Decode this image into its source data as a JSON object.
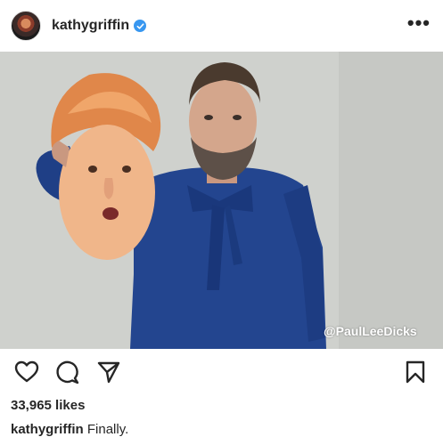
{
  "post": {
    "username": "kathygriffin",
    "verified": true,
    "more_label": "•••",
    "photo": {
      "watermark": "@PaulLeeDicks"
    },
    "actions": {
      "like_icon": "heart-icon",
      "comment_icon": "comment-icon",
      "share_icon": "share-icon",
      "save_icon": "bookmark-icon"
    },
    "likes": "33,965 likes",
    "caption": {
      "username": "kathygriffin",
      "text": "Finally."
    }
  },
  "colors": {
    "text": "#262626",
    "verified_blue": "#3897f0",
    "background": "#ffffff"
  }
}
